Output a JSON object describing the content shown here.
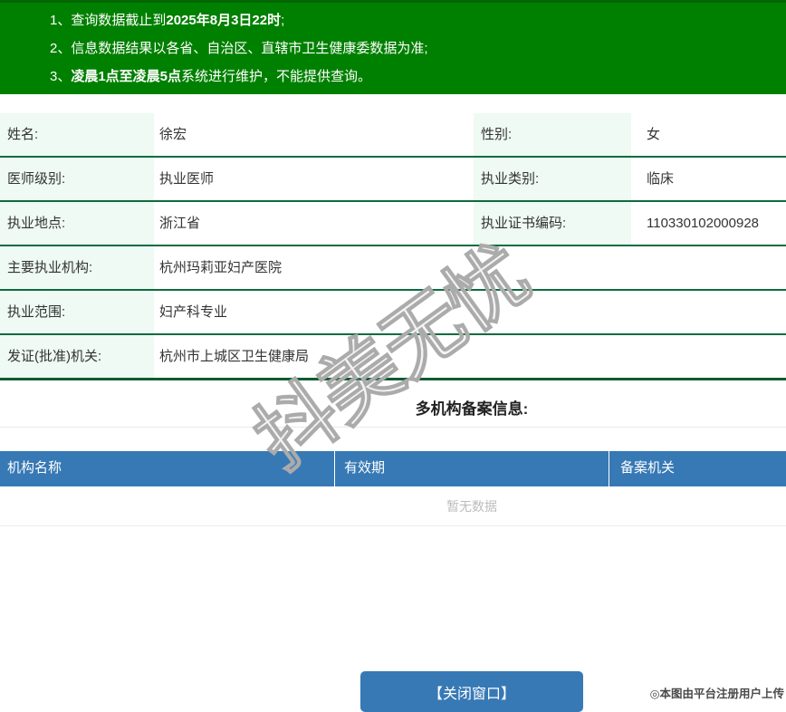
{
  "notices": {
    "items": [
      {
        "num": "1、",
        "pre": "查询数据截止到",
        "bold": "2025年8月3日22时",
        "post": ";"
      },
      {
        "num": "2、",
        "pre": "信息数据结果以各省、自治区、直辖市卫生健康委数据为准;",
        "bold": "",
        "post": ""
      },
      {
        "num": "3、",
        "pre": "",
        "bold": "凌晨1点至凌晨5点",
        "post": "系统进行维护，不能提供查询。"
      }
    ]
  },
  "doctor": {
    "name": {
      "label": "姓名:",
      "value": "徐宏"
    },
    "gender": {
      "label": "性别:",
      "value": "女"
    },
    "level": {
      "label": "医师级别:",
      "value": "执业医师"
    },
    "category": {
      "label": "执业类别:",
      "value": "临床"
    },
    "location": {
      "label": "执业地点:",
      "value": "浙江省"
    },
    "cert_no": {
      "label": "执业证书编码:",
      "value": "110330102000928"
    },
    "main_org": {
      "label": "主要执业机构:",
      "value": "杭州玛莉亚妇产医院"
    },
    "scope": {
      "label": "执业范围:",
      "value": "妇产科专业"
    },
    "issuer": {
      "label": "发证(批准)机关:",
      "value": "杭州市上城区卫生健康局"
    }
  },
  "filing": {
    "title": "多机构备案信息:",
    "columns": [
      "机构名称",
      "有效期",
      "备案机关"
    ],
    "empty_text": "暂无数据"
  },
  "footer": {
    "close_button": "【关闭窗口】"
  },
  "watermarks": {
    "diagonal": "抖美无忧",
    "photo_credit": "◎本图由平台注册用户上传"
  },
  "colors": {
    "banner_green": "#008000",
    "row_border_green": "#0d6b3f",
    "label_cell_mint": "#eefaf3",
    "header_blue": "#3779b5",
    "button_blue": "#3779b5"
  }
}
